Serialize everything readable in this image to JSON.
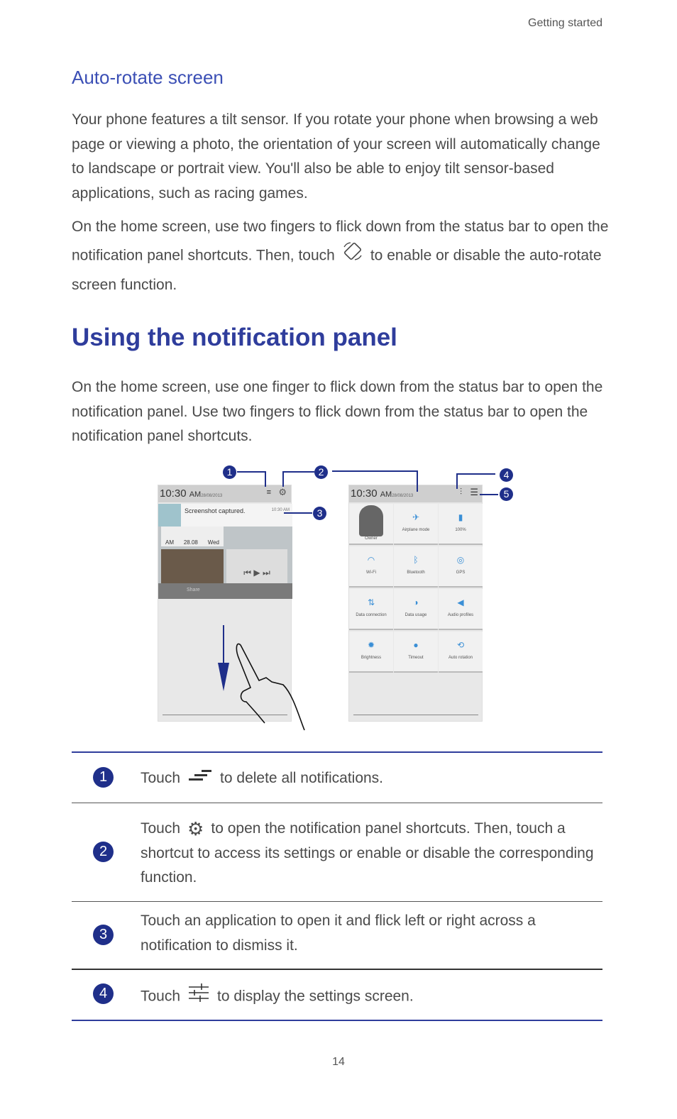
{
  "header": {
    "section": "Getting started"
  },
  "auto_rotate": {
    "title": "Auto-rotate  screen",
    "para1": "Your phone features a tilt sensor. If you rotate your phone when browsing a web page or viewing a photo, the orientation of your screen will automatically change to landscape or portrait view. You'll also be able to enjoy tilt sensor-based applications, such as racing games.",
    "para2_before": "On the home screen, use two fingers to flick down from the status bar to open the notification panel shortcuts. Then, touch",
    "para2_after": "to enable or disable the auto-rotate screen function.",
    "icon": "auto-rotate-icon"
  },
  "notification": {
    "title": "Using the notification panel",
    "para": "On the home screen, use one finger to flick down from the status bar to open the notification panel. Use two fingers to flick down from the status bar to open the notification panel shortcuts."
  },
  "figure": {
    "left": {
      "time": "10:30",
      "ampm": "AM",
      "date": "28/08/2013",
      "notif_text": "Screenshot captured.",
      "notif_time": "10:30 AM",
      "widget": [
        "AM",
        "28.08",
        "Wed"
      ],
      "share": "Share"
    },
    "right": {
      "time": "10:30",
      "ampm": "AM",
      "date": "28/08/2013",
      "owner": "Owner",
      "tiles": [
        {
          "label": "Airplane mode",
          "icon": "✈"
        },
        {
          "label": "100%",
          "icon": "▮"
        },
        {
          "label": "Wi-Fi",
          "icon": "◠"
        },
        {
          "label": "Bluetooth",
          "icon": "ᛒ"
        },
        {
          "label": "GPS",
          "icon": "◎"
        },
        {
          "label": "Data connection",
          "icon": "⇅"
        },
        {
          "label": "Data usage",
          "icon": "◑"
        },
        {
          "label": "Audio profiles",
          "icon": "◀"
        },
        {
          "label": "Brightness",
          "icon": "✹"
        },
        {
          "label": "Timeout",
          "icon": "●"
        },
        {
          "label": "Auto rotation",
          "icon": "⟲"
        }
      ]
    },
    "callouts": [
      "1",
      "2",
      "3",
      "4",
      "5"
    ]
  },
  "table": [
    {
      "num": "1",
      "before": "Touch",
      "icon": "clear-notifications-icon",
      "after": "to delete all notifications."
    },
    {
      "num": "2",
      "before": "Touch",
      "icon": "settings-gear-icon",
      "after": "to open the notification panel shortcuts. Then, touch a shortcut to access its settings or enable or disable the corresponding function."
    },
    {
      "num": "3",
      "text": "Touch an application to open it and flick left or right across a notification to dismiss it."
    },
    {
      "num": "4",
      "before": "Touch",
      "icon": "settings-sliders-icon",
      "after": "to display the settings screen."
    }
  ],
  "colors": {
    "heading": "#2f3d9c",
    "callout": "#1f2f8a"
  },
  "page_number": "14"
}
